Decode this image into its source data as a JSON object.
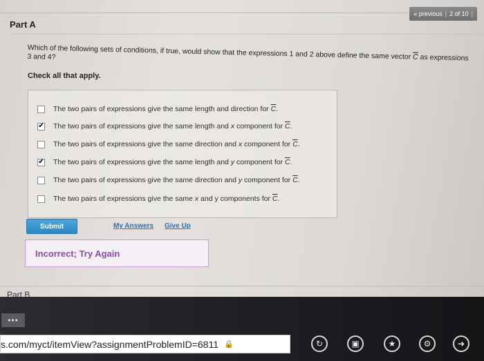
{
  "nav": {
    "previous": "« previous",
    "separator": "|",
    "page": "2 of 10",
    "extra": "|"
  },
  "part_a": {
    "title": "Part A"
  },
  "question": {
    "text_before": "Which of the following sets of conditions, if true, would show that the expressions 1 and 2 above define the same vector ",
    "vector": "C",
    "text_after": " as expressions 3 and 4?"
  },
  "check_all": "Check all that apply.",
  "options": [
    {
      "pre": "The two pairs of expressions give the same length and direction for ",
      "var": "",
      "post": "",
      "vec": "C",
      "end": ".",
      "checked": false
    },
    {
      "pre": "The two pairs of expressions give the same length and ",
      "var": "x",
      "post": " component for ",
      "vec": "C",
      "end": ".",
      "checked": true
    },
    {
      "pre": "The two pairs of expressions give the same direction and ",
      "var": "x",
      "post": " component for ",
      "vec": "C",
      "end": ".",
      "checked": false
    },
    {
      "pre": "The two pairs of expressions give the same length and ",
      "var": "y",
      "post": " component for ",
      "vec": "C",
      "end": ".",
      "checked": true
    },
    {
      "pre": "The two pairs of expressions give the same direction and ",
      "var": "y",
      "post": " component for ",
      "vec": "C",
      "end": ".",
      "checked": false
    },
    {
      "pre": "The two pairs of expressions give the same ",
      "var": "x",
      "post": " and y components for ",
      "vec": "C",
      "end": ".",
      "checked": false
    }
  ],
  "buttons": {
    "submit": "Submit",
    "my_answers": "My Answers",
    "give_up": "Give Up"
  },
  "feedback": "Incorrect; Try Again",
  "part_b": {
    "title": "Part B"
  },
  "taskbar": {
    "dots": "•••",
    "url": "s.com/myct/itemView?assignmentProblemID=6811",
    "icons": [
      "refresh-icon",
      "tabs-icon",
      "favorite-star-icon",
      "settings-wrench-icon",
      "forward-icon"
    ]
  }
}
